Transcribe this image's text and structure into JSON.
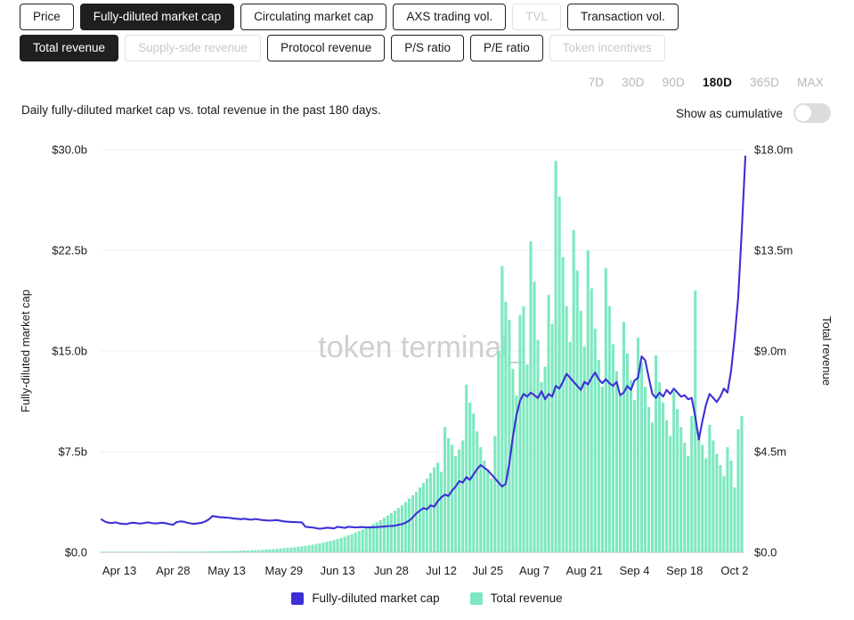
{
  "metric_rows": [
    [
      {
        "label": "Price",
        "state": "default"
      },
      {
        "label": "Fully-diluted market cap",
        "state": "active"
      },
      {
        "label": "Circulating market cap",
        "state": "default"
      },
      {
        "label": "AXS trading vol.",
        "state": "default"
      },
      {
        "label": "TVL",
        "state": "disabled"
      },
      {
        "label": "Transaction vol.",
        "state": "default"
      }
    ],
    [
      {
        "label": "Total revenue",
        "state": "active"
      },
      {
        "label": "Supply-side revenue",
        "state": "disabled"
      },
      {
        "label": "Protocol revenue",
        "state": "default"
      },
      {
        "label": "P/S ratio",
        "state": "default"
      },
      {
        "label": "P/E ratio",
        "state": "default"
      },
      {
        "label": "Token incentives",
        "state": "disabled"
      }
    ]
  ],
  "ranges": [
    {
      "label": "7D",
      "active": false
    },
    {
      "label": "30D",
      "active": false
    },
    {
      "label": "90D",
      "active": false
    },
    {
      "label": "180D",
      "active": true
    },
    {
      "label": "365D",
      "active": false
    },
    {
      "label": "MAX",
      "active": false
    }
  ],
  "caption": "Daily fully-diluted market cap vs. total revenue in the past 180 days.",
  "cumulative": {
    "label": "Show as cumulative",
    "enabled": false
  },
  "watermark": "token terminal_",
  "legend": [
    {
      "label": "Fully-diluted market cap",
      "color": "#3D2FD6"
    },
    {
      "label": "Total revenue",
      "color": "#7EE8C0"
    }
  ],
  "colors": {
    "line": "#3D2FD6",
    "bar": "#7EE8C0",
    "grid": "#f0f0f0",
    "axis": "#bdbdbd",
    "active_bg": "#1f1f1f",
    "disabled_text": "#c9c9c9"
  },
  "chart_data": {
    "type": "line",
    "title": "Daily fully-diluted market cap vs. total revenue in the past 180 days.",
    "xlabel": "",
    "ylabel": "Fully-diluted market cap",
    "y2label": "Total revenue",
    "grid": true,
    "legend_position": "bottom",
    "ylim": [
      0,
      30000000000
    ],
    "y2lim": [
      0,
      18000000
    ],
    "yticks": [
      0,
      7500000000,
      15000000000,
      22500000000,
      30000000000
    ],
    "ytick_labels": [
      "$0.0",
      "$7.5b",
      "$15.0b",
      "$22.5b",
      "$30.0b"
    ],
    "y2ticks": [
      0,
      4500000,
      9000000,
      13500000,
      18000000
    ],
    "y2tick_labels": [
      "$0.0",
      "$4.5m",
      "$9.0m",
      "$13.5m",
      "$18.0m"
    ],
    "xtick_labels": [
      "Apr 13",
      "Apr 28",
      "May 13",
      "May 29",
      "Jun 13",
      "Jun 28",
      "Jul 12",
      "Jul 25",
      "Aug 7",
      "Aug 21",
      "Sep 4",
      "Sep 18",
      "Oct 2"
    ],
    "xtick_indices": [
      5,
      20,
      35,
      51,
      66,
      81,
      95,
      108,
      121,
      135,
      149,
      163,
      177
    ],
    "n_points": 180,
    "series": [
      {
        "name": "Fully-diluted market cap",
        "type": "line",
        "axis": "left",
        "color": "#3D2FD6",
        "unit": "USD",
        "values": [
          2450000000,
          2280000000,
          2200000000,
          2180000000,
          2230000000,
          2150000000,
          2120000000,
          2100000000,
          2180000000,
          2200000000,
          2160000000,
          2140000000,
          2190000000,
          2230000000,
          2180000000,
          2150000000,
          2170000000,
          2200000000,
          2160000000,
          2100000000,
          2050000000,
          2250000000,
          2300000000,
          2280000000,
          2200000000,
          2150000000,
          2120000000,
          2160000000,
          2200000000,
          2300000000,
          2450000000,
          2700000000,
          2660000000,
          2620000000,
          2600000000,
          2580000000,
          2560000000,
          2520000000,
          2490000000,
          2470000000,
          2500000000,
          2450000000,
          2430000000,
          2480000000,
          2440000000,
          2400000000,
          2380000000,
          2360000000,
          2380000000,
          2400000000,
          2350000000,
          2300000000,
          2280000000,
          2260000000,
          2250000000,
          2240000000,
          2230000000,
          1900000000,
          1870000000,
          1850000000,
          1800000000,
          1750000000,
          1790000000,
          1830000000,
          1810000000,
          1780000000,
          1900000000,
          1860000000,
          1820000000,
          1900000000,
          1880000000,
          1850000000,
          1870000000,
          1880000000,
          1860000000,
          1850000000,
          1870000000,
          1880000000,
          1900000000,
          1920000000,
          1950000000,
          1960000000,
          1980000000,
          2050000000,
          2100000000,
          2200000000,
          2350000000,
          2600000000,
          2900000000,
          3100000000,
          3300000000,
          3200000000,
          3500000000,
          3400000000,
          3800000000,
          4100000000,
          4300000000,
          4200000000,
          4600000000,
          4900000000,
          5300000000,
          5200000000,
          5600000000,
          5400000000,
          5800000000,
          6200000000,
          6500000000,
          6300000000,
          6100000000,
          5800000000,
          5500000000,
          5200000000,
          4900000000,
          5100000000,
          6600000000,
          8600000000,
          10200000000,
          11300000000,
          11800000000,
          11600000000,
          11900000000,
          11700000000,
          11500000000,
          12000000000,
          11400000000,
          11800000000,
          11600000000,
          12400000000,
          12200000000,
          12700000000,
          13300000000,
          13000000000,
          12700000000,
          12400000000,
          12100000000,
          12700000000,
          12500000000,
          13000000000,
          13400000000,
          12900000000,
          12600000000,
          12900000000,
          12600000000,
          12400000000,
          12700000000,
          11700000000,
          11900000000,
          12400000000,
          12100000000,
          12800000000,
          13000000000,
          14600000000,
          14300000000,
          13000000000,
          11800000000,
          11500000000,
          11900000000,
          11600000000,
          12100000000,
          11800000000,
          12200000000,
          11900000000,
          11600000000,
          11700000000,
          11400000000,
          11500000000,
          10100000000,
          8400000000,
          9800000000,
          11000000000,
          11800000000,
          11500000000,
          11200000000,
          11600000000,
          12200000000,
          11900000000,
          13500000000,
          16000000000,
          19000000000,
          24000000000,
          29500000000
        ]
      },
      {
        "name": "Total revenue",
        "type": "bar",
        "axis": "right",
        "color": "#7EE8C0",
        "unit": "USD",
        "values": [
          20000,
          22000,
          18000,
          25000,
          21000,
          19000,
          24000,
          26000,
          22000,
          20000,
          23000,
          25000,
          21000,
          24000,
          27000,
          23000,
          20000,
          22000,
          26000,
          28000,
          25000,
          30000,
          35000,
          32000,
          29000,
          31000,
          34000,
          36000,
          33000,
          38000,
          42000,
          48000,
          45000,
          50000,
          55000,
          60000,
          58000,
          62000,
          68000,
          72000,
          78000,
          85000,
          90000,
          95000,
          100000,
          110000,
          120000,
          130000,
          140000,
          150000,
          165000,
          180000,
          195000,
          210000,
          230000,
          250000,
          270000,
          290000,
          310000,
          340000,
          370000,
          400000,
          430000,
          470000,
          510000,
          550000,
          600000,
          650000,
          700000,
          760000,
          820000,
          880000,
          950000,
          1020000,
          1100000,
          1180000,
          1260000,
          1350000,
          1440000,
          1540000,
          1640000,
          1750000,
          1860000,
          1980000,
          2100000,
          2250000,
          2400000,
          2550000,
          2700000,
          2900000,
          3100000,
          3300000,
          3550000,
          3800000,
          4000000,
          3600000,
          5600000,
          5100000,
          4800000,
          4300000,
          4600000,
          5000000,
          7500000,
          6700000,
          6200000,
          5400000,
          4700000,
          4100000,
          3700000,
          3300000,
          5200000,
          9000000,
          12800000,
          11200000,
          10400000,
          8200000,
          7000000,
          10600000,
          11000000,
          8400000,
          13900000,
          12100000,
          9500000,
          7600000,
          8300000,
          11500000,
          10200000,
          17500000,
          15900000,
          13200000,
          11000000,
          9400000,
          14400000,
          12600000,
          10800000,
          9200000,
          13500000,
          11800000,
          10000000,
          8600000,
          7400000,
          12700000,
          11000000,
          9300000,
          8100000,
          7000000,
          10300000,
          8900000,
          7700000,
          6800000,
          9600000,
          8500000,
          7400000,
          6500000,
          5800000,
          8800000,
          7600000,
          6700000,
          5900000,
          5200000,
          7200000,
          6400000,
          5600000,
          4900000,
          4300000,
          6100000,
          11700000,
          5400000,
          4800000,
          4200000,
          5700000,
          5000000,
          4400000,
          3900000,
          3400000,
          4700000,
          4100000,
          2900000,
          5500000,
          6100000
        ]
      }
    ]
  }
}
